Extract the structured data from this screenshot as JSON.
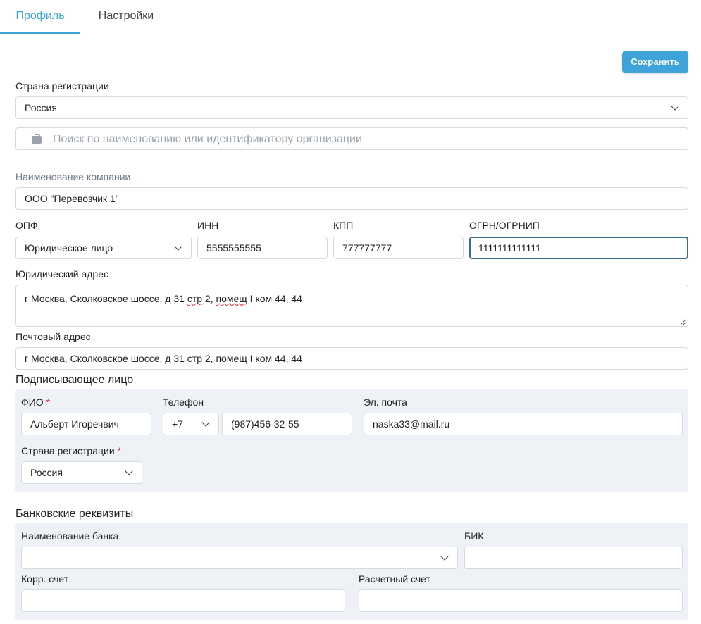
{
  "tabs": [
    {
      "label": "Профиль",
      "active": true
    },
    {
      "label": "Настройки",
      "active": false
    }
  ],
  "toolbar": {
    "save_label": "Сохранить"
  },
  "registration": {
    "label": "Страна регистрации",
    "value": "Россия"
  },
  "search": {
    "placeholder": "Поиск по наименованию или идентификатору организации",
    "icon": "briefcase-icon"
  },
  "company": {
    "name_label": "Наименование компании",
    "name_value": "ООО \"Перевозчик 1\"",
    "opf_label": "ОПФ",
    "opf_value": "Юридическое лицо",
    "inn_label": "ИНН",
    "inn_value": "5555555555",
    "kpp_label": "КПП",
    "kpp_value": "777777777",
    "ogrn_label": "ОГРН/ОГРНИП",
    "ogrn_value": "1111111111111",
    "legal_address_label": "Юридический адрес",
    "legal_address_prefix": "г Москва, Сколковское шоссе, д 31 ",
    "legal_address_w1": "стр",
    "legal_address_mid": " 2, ",
    "legal_address_w2": "помещ",
    "legal_address_suffix": " I ком 44, 44",
    "postal_address_label": "Почтовый адрес",
    "postal_address_value": "г Москва, Сколковское шоссе, д 31 стр 2, помещ I ком 44, 44"
  },
  "signer": {
    "title": "Подписывающее лицо",
    "fio_label": "ФИО",
    "fio_value": "Альберт Игоречвич",
    "required_mark": "*",
    "phone_label": "Телефон",
    "phone_code": "+7",
    "phone_value": "(987)456-32-55",
    "email_label": "Эл. почта",
    "email_value": "naska33@mail.ru",
    "country_label": "Страна регистрации",
    "country_value": "Россия"
  },
  "bank": {
    "title": "Банковские реквизиты",
    "bank_name_label": "Наименование банка",
    "bank_name_value": "",
    "bik_label": "БИК",
    "bik_value": "",
    "corr_label": "Корр. счет",
    "corr_value": "",
    "account_label": "Расчетный счет",
    "account_value": ""
  },
  "colors": {
    "accent": "#3aa3d9",
    "panel": "#eef1f5",
    "required": "#e03030",
    "focus_border": "#3b6f8f"
  }
}
